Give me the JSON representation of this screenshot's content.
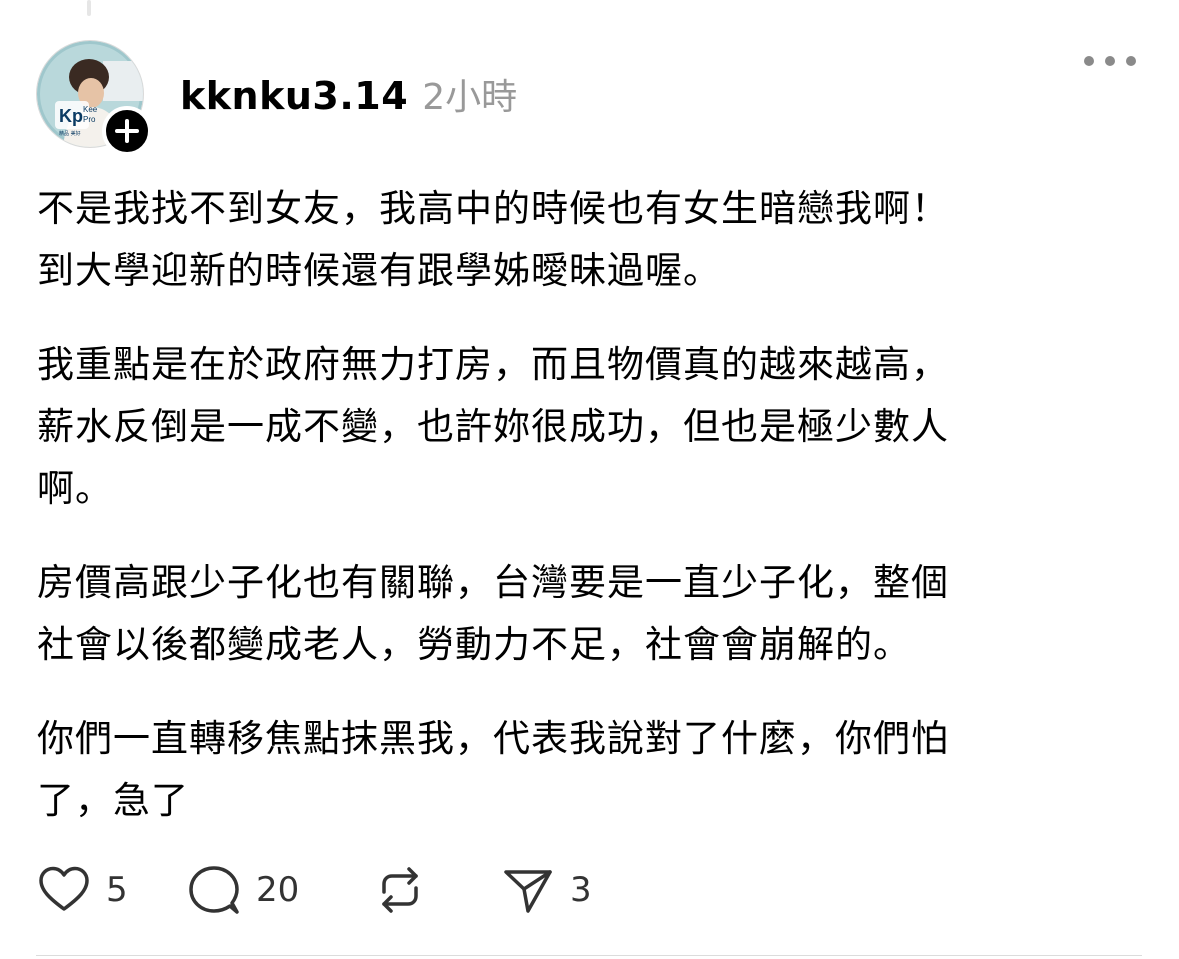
{
  "post": {
    "username": "kknku3.14",
    "timestamp": "2小時",
    "avatar": {
      "logo_text": "Kp",
      "lines": [
        "Kee",
        "Pro"
      ],
      "caption": "精品 美好"
    },
    "paragraphs": [
      "不是我找不到女友，我高中的時候也有女生暗戀我啊！\n到大學迎新的時候還有跟學姊曖昧過喔。",
      "我重點是在於政府無力打房，而且物價真的越來越高，\n薪水反倒是一成不變，也許妳很成功，但也是極少數人\n啊。",
      "房價高跟少子化也有關聯，台灣要是一直少子化，整個\n社會以後都變成老人，勞動力不足，社會會崩解的。",
      "你們一直轉移焦點抹黑我，代表我說對了什麼，你們怕\n了，急了"
    ]
  },
  "actions": {
    "like_count": "5",
    "comment_count": "20",
    "share_count": "3"
  },
  "icons": {
    "like": "heart-icon",
    "comment": "comment-bubble-icon",
    "repost": "repost-icon",
    "share": "send-icon",
    "more": "more-dots-icon",
    "follow": "plus-icon"
  },
  "colors": {
    "text": "#000000",
    "muted": "#999999",
    "icon": "#333333"
  }
}
